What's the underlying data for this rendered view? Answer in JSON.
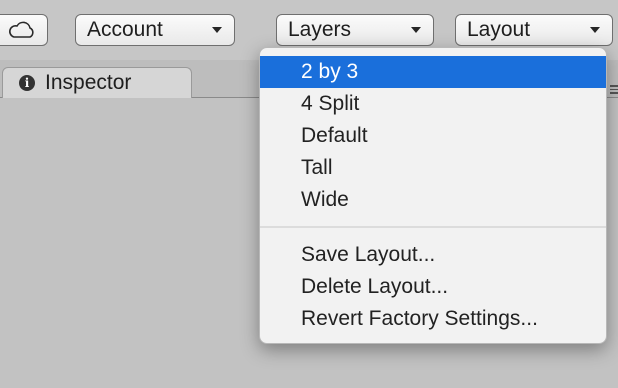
{
  "toolbar": {
    "cloud_icon": "cloud-icon",
    "account_label": "Account",
    "layers_label": "Layers",
    "layout_label": "Layout"
  },
  "tabs": [
    {
      "label": "Inspector",
      "icon": "info-icon",
      "icon_glyph": "i"
    }
  ],
  "layout_menu": {
    "selected_color": "#1a6fdb",
    "items": [
      {
        "label": "2 by 3",
        "selected": true
      },
      {
        "label": "4 Split"
      },
      {
        "label": "Default"
      },
      {
        "label": "Tall"
      },
      {
        "label": "Wide"
      }
    ],
    "actions": [
      {
        "label": "Save Layout..."
      },
      {
        "label": "Delete Layout..."
      },
      {
        "label": "Revert Factory Settings..."
      }
    ]
  }
}
